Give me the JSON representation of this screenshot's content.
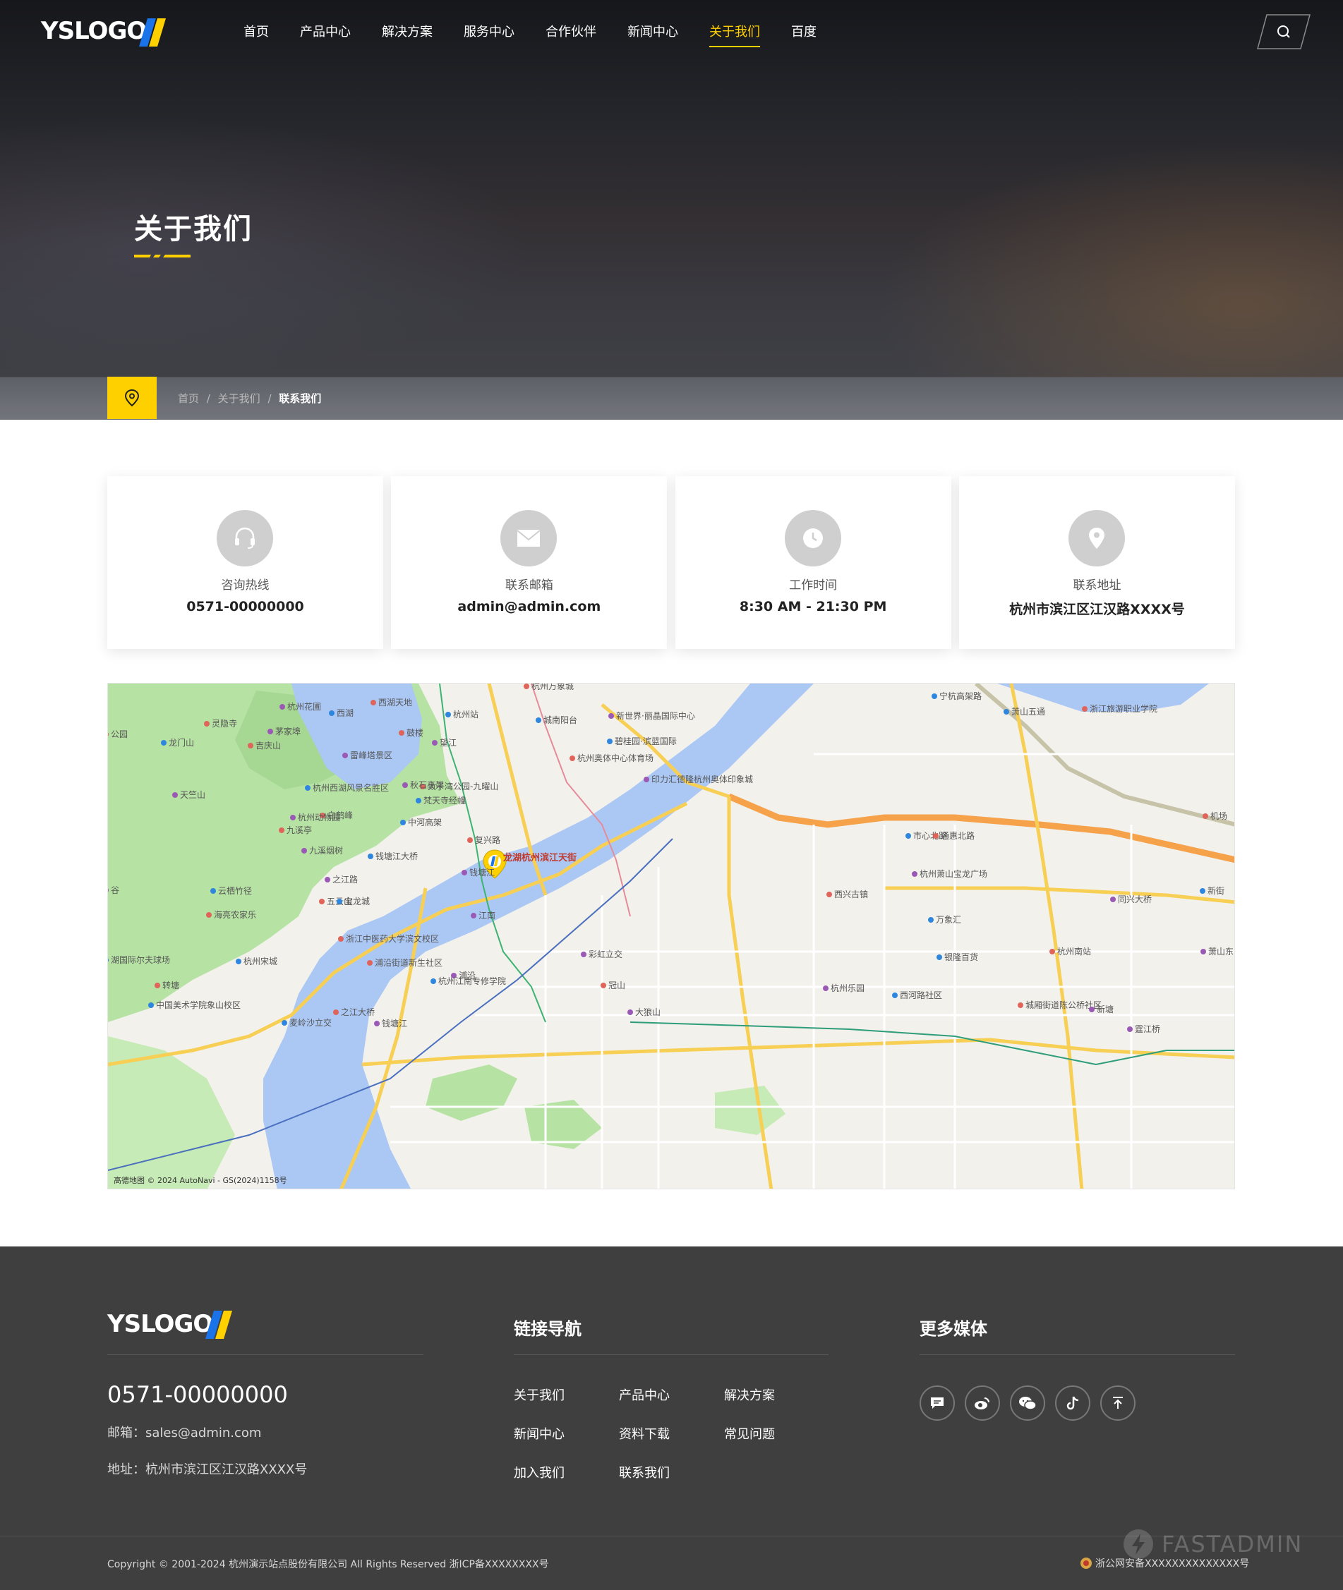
{
  "nav": {
    "logo": "YSLOGO",
    "items": [
      {
        "label": "首页"
      },
      {
        "label": "产品中心"
      },
      {
        "label": "解决方案"
      },
      {
        "label": "服务中心"
      },
      {
        "label": "合作伙伴"
      },
      {
        "label": "新闻中心"
      },
      {
        "label": "关于我们"
      },
      {
        "label": "百度"
      }
    ],
    "active_index": 6
  },
  "hero": {
    "title": "关于我们"
  },
  "breadcrumb": {
    "home": "首页",
    "sep": "/",
    "parent": "关于我们",
    "current": "联系我们"
  },
  "contact_cards": [
    {
      "icon": "headset-icon",
      "label": "咨询热线",
      "value": "0571-00000000"
    },
    {
      "icon": "mail-icon",
      "label": "联系邮箱",
      "value": "admin@admin.com"
    },
    {
      "icon": "clock-icon",
      "label": "工作时间",
      "value": "8:30 AM - 21:30 PM"
    },
    {
      "icon": "location-pin-icon",
      "label": "联系地址",
      "value": "杭州市滨江区江汉路XXXX号"
    }
  ],
  "map": {
    "marker_label": "龙湖杭州滨江天街",
    "attribution": "高德地图 © 2024 AutoNavi - GS(2024)1158号",
    "labels": [
      {
        "t": "西湖天地"
      },
      {
        "t": "杭州花圃"
      },
      {
        "t": "西湖"
      },
      {
        "t": "灵隐寺"
      },
      {
        "t": "茅家埠"
      },
      {
        "t": "龙门山"
      },
      {
        "t": "吉庆山"
      },
      {
        "t": "雷峰塔景区"
      },
      {
        "t": "杭州站"
      },
      {
        "t": "鼓楼"
      },
      {
        "t": "望江"
      },
      {
        "t": "城南阳台"
      },
      {
        "t": "杭州万象城"
      },
      {
        "t": "新世界·丽晶国际中心"
      },
      {
        "t": "碧桂园·滨蓝国际"
      },
      {
        "t": "杭州奥体中心体育场"
      },
      {
        "t": "印力汇德隆杭州奥体印象城"
      },
      {
        "t": "萧山五通"
      },
      {
        "t": "浙江旅游职业学院"
      },
      {
        "t": "天竺山"
      },
      {
        "t": "杭州西湖风景名胜区"
      },
      {
        "t": "太子湾公园-九曜山"
      },
      {
        "t": "秋石高架"
      },
      {
        "t": "梵天寺经幢"
      },
      {
        "t": "白鹤峰"
      },
      {
        "t": "杭州动物园"
      },
      {
        "t": "中河高架"
      },
      {
        "t": "九溪亭"
      },
      {
        "t": "九溪烟树"
      },
      {
        "t": "钱塘江大桥"
      },
      {
        "t": "复兴路"
      },
      {
        "t": "钱塘江"
      },
      {
        "t": "市心北路"
      },
      {
        "t": "通惠北路"
      },
      {
        "t": "杭州萧山宝龙广场"
      },
      {
        "t": "云栖竹径"
      },
      {
        "t": "五云山"
      },
      {
        "t": "之江路"
      },
      {
        "t": "宝龙城"
      },
      {
        "t": "西兴古镇"
      },
      {
        "t": "同兴大桥"
      },
      {
        "t": "新街"
      },
      {
        "t": "海亮农家乐"
      },
      {
        "t": "江南"
      },
      {
        "t": "万象汇"
      },
      {
        "t": "浙江中医药大学滨文校区"
      },
      {
        "t": "彩虹立交"
      },
      {
        "t": "银隆百货"
      },
      {
        "t": "杭州南站"
      },
      {
        "t": "萧山东"
      },
      {
        "t": "杭州宋城"
      },
      {
        "t": "浦沿街道新生社区"
      },
      {
        "t": "浦沿"
      },
      {
        "t": "杭州江南专修学院"
      },
      {
        "t": "冠山"
      },
      {
        "t": "杭州乐园"
      },
      {
        "t": "西河路社区"
      },
      {
        "t": "城厢街道陈公桥社区"
      },
      {
        "t": "新塘"
      },
      {
        "t": "中国美术学院象山校区"
      },
      {
        "t": "转塘"
      },
      {
        "t": "大狼山"
      },
      {
        "t": "麦岭沙立交"
      },
      {
        "t": "之江大桥"
      },
      {
        "t": "钱塘江"
      },
      {
        "t": "宁杭高架路"
      },
      {
        "t": "机场"
      },
      {
        "t": "霆江桥"
      },
      {
        "t": "湖国际尔夫球场"
      },
      {
        "t": "公园"
      },
      {
        "t": "谷"
      }
    ]
  },
  "footer": {
    "logo": "YSLOGO",
    "phone": "0571-00000000",
    "email": "邮箱：sales@admin.com",
    "address": "地址：杭州市滨江区江汉路XXXX号",
    "links_title": "链接导航",
    "links": [
      "关于我们",
      "产品中心",
      "解决方案",
      "新闻中心",
      "资料下载",
      "常见问题",
      "加入我们",
      "联系我们"
    ],
    "media_title": "更多媒体",
    "media_icons": [
      "message-icon",
      "weibo-icon",
      "wechat-icon",
      "tiktok-icon",
      "back-to-top-icon"
    ],
    "copyright": "Copyright © 2001-2024 杭州演示站点股份有限公司 All Rights Reserved 浙ICP备XXXXXXXX号",
    "beian": "浙公网安备XXXXXXXXXXXXXX号",
    "watermark": "FASTADMIN"
  },
  "colors": {
    "accent": "#ffd000",
    "logo_blue": "#1a73e8",
    "footer_bg": "#3f3f40",
    "icon_gray": "#cfcfcf"
  }
}
